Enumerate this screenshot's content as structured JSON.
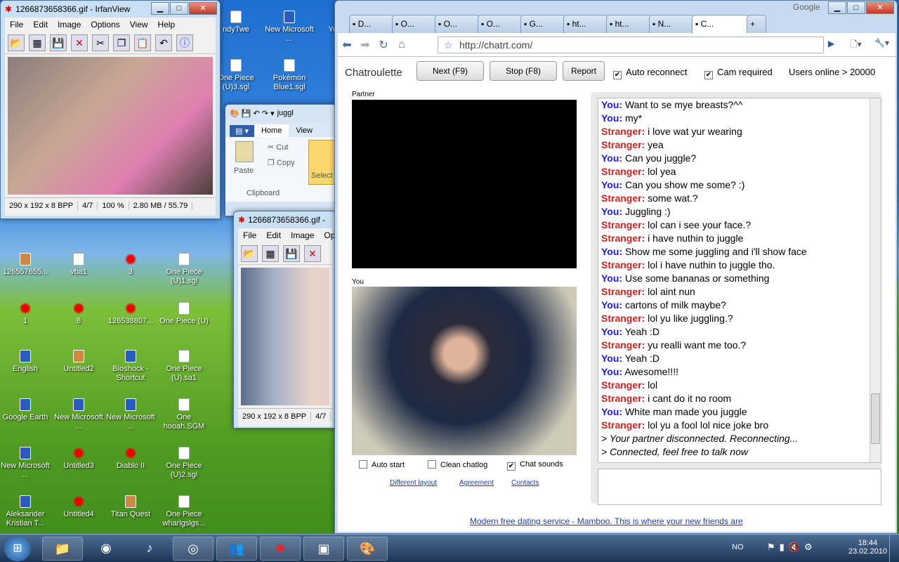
{
  "desktop_icons": [
    {
      "label": "ndyTwe"
    },
    {
      "label": "New Microsoft ..."
    },
    {
      "label": "Yo Lars"
    },
    {
      "label": "One Piece (U)3.sgl"
    },
    {
      "label": "Pokémon Blue1.sgl"
    },
    {
      "label": "126557655..."
    },
    {
      "label": "vba1"
    },
    {
      "label": "3"
    },
    {
      "label": "One Piece (U)1.sgl"
    },
    {
      "label": "1"
    },
    {
      "label": "8"
    },
    {
      "label": "126538807..."
    },
    {
      "label": "One Piece (U)"
    },
    {
      "label": "English"
    },
    {
      "label": "Untitled2"
    },
    {
      "label": "Bioshock - Shortcut"
    },
    {
      "label": "One Piece (U).sa1"
    },
    {
      "label": "Google Earth"
    },
    {
      "label": "New Microsoft ..."
    },
    {
      "label": "New Microsoft ..."
    },
    {
      "label": "One hooah.SGM"
    },
    {
      "label": "New Microsoft ..."
    },
    {
      "label": "Untitled3"
    },
    {
      "label": "Diablo II"
    },
    {
      "label": "One Piece (U)2.sgl"
    },
    {
      "label": "Aleksander Kristian T..."
    },
    {
      "label": "Untitled4"
    },
    {
      "label": "Titan Quest"
    },
    {
      "label": "One Piece wharlgslgs..."
    }
  ],
  "irfan1": {
    "title": "1266873658366.gif - IrfanView",
    "menu": [
      "File",
      "Edit",
      "Image",
      "Options",
      "View",
      "Help"
    ],
    "status": [
      "290 x 192 x 8 BPP",
      "4/7",
      "100 %",
      "2.80 MB / 55.79"
    ]
  },
  "paint": {
    "title": "juggl",
    "tabs": [
      "Home",
      "View"
    ],
    "paste": "Paste",
    "cut": "Cut",
    "copy": "Copy",
    "clipboard": "Clipboard",
    "select": "Select"
  },
  "irfan2": {
    "title": "1266873658366.gif -",
    "menu": [
      "File",
      "Edit",
      "Image",
      "Op"
    ],
    "status": [
      "290 x 192 x 8 BPP",
      "4/7"
    ],
    "icons": [
      "126557655...",
      "vba1"
    ]
  },
  "chrome": {
    "tabs": [
      "D...",
      "O...",
      "O...",
      "O...",
      "G...",
      "ht...",
      "ht...",
      "N...",
      "C..."
    ],
    "google_label": "Google",
    "url": "http://chatrt.com/"
  },
  "chatrt": {
    "brand": "Chatroulette",
    "next": "Next (F9)",
    "stop": "Stop (F8)",
    "report": "Report",
    "auto_reconnect": "Auto reconnect",
    "cam_required": "Cam required",
    "users_online": "Users online > 20000",
    "partner_label": "Partner",
    "you_label": "You",
    "auto_start": "Auto start",
    "clean_chatlog": "Clean chatlog",
    "chat_sounds": "Chat sounds",
    "links": [
      "Different layout",
      "Agreement",
      "Contacts"
    ],
    "footer_link": "Modern free dating service - Mamboo. This is where your new friends are",
    "chat": [
      {
        "who": "You:",
        "text": " Want to se mye breasts?^^",
        "k": "y"
      },
      {
        "who": "You:",
        "text": " my*",
        "k": "y"
      },
      {
        "who": "Stranger:",
        "text": " i love wat yur wearing",
        "k": "s"
      },
      {
        "who": "Stranger:",
        "text": " yea",
        "k": "s"
      },
      {
        "who": "You:",
        "text": " Can you juggle?",
        "k": "y"
      },
      {
        "who": "Stranger:",
        "text": " lol yea",
        "k": "s"
      },
      {
        "who": "You:",
        "text": " Can you show me some? :)",
        "k": "y"
      },
      {
        "who": "Stranger:",
        "text": " some wat.?",
        "k": "s"
      },
      {
        "who": "You:",
        "text": " Juggling :)",
        "k": "y"
      },
      {
        "who": "Stranger:",
        "text": " lol can i see your face.?",
        "k": "s"
      },
      {
        "who": "Stranger:",
        "text": " i have nuthin to juggle",
        "k": "s"
      },
      {
        "who": "You:",
        "text": " Show me some juggling and i'll show face",
        "k": "y"
      },
      {
        "who": "Stranger:",
        "text": " lol i have nuthin to juggle tho.",
        "k": "s"
      },
      {
        "who": "You:",
        "text": " Use some bananas or something",
        "k": "y"
      },
      {
        "who": "Stranger:",
        "text": " lol aint nun",
        "k": "s"
      },
      {
        "who": "You:",
        "text": " cartons of milk maybe?",
        "k": "y"
      },
      {
        "who": "Stranger:",
        "text": " lol yu like juggling.?",
        "k": "s"
      },
      {
        "who": "You:",
        "text": " Yeah :D",
        "k": "y"
      },
      {
        "who": "Stranger:",
        "text": " yu realli want me too.?",
        "k": "s"
      },
      {
        "who": "You:",
        "text": " Yeah :D",
        "k": "y"
      },
      {
        "who": "You:",
        "text": " Awesome!!!!",
        "k": "y"
      },
      {
        "who": "Stranger:",
        "text": " lol",
        "k": "s"
      },
      {
        "who": "Stranger:",
        "text": " i cant do it no room",
        "k": "s"
      },
      {
        "who": "You:",
        "text": " White man made you juggle",
        "k": "y"
      },
      {
        "who": "Stranger:",
        "text": " lol yu a fool lol nice joke bro",
        "k": "s"
      },
      {
        "who": "",
        "text": "> Your partner disconnected. Reconnecting...",
        "k": "sys"
      },
      {
        "who": "",
        "text": "> Connected, feel free to talk now",
        "k": "sys"
      }
    ]
  },
  "taskbar": {
    "lang": "NO",
    "time": "18:44",
    "date": "23.02.2010"
  },
  "colors": {
    "you": "#1a1adc",
    "stranger": "#d42020",
    "link": "#1a3fa8"
  }
}
